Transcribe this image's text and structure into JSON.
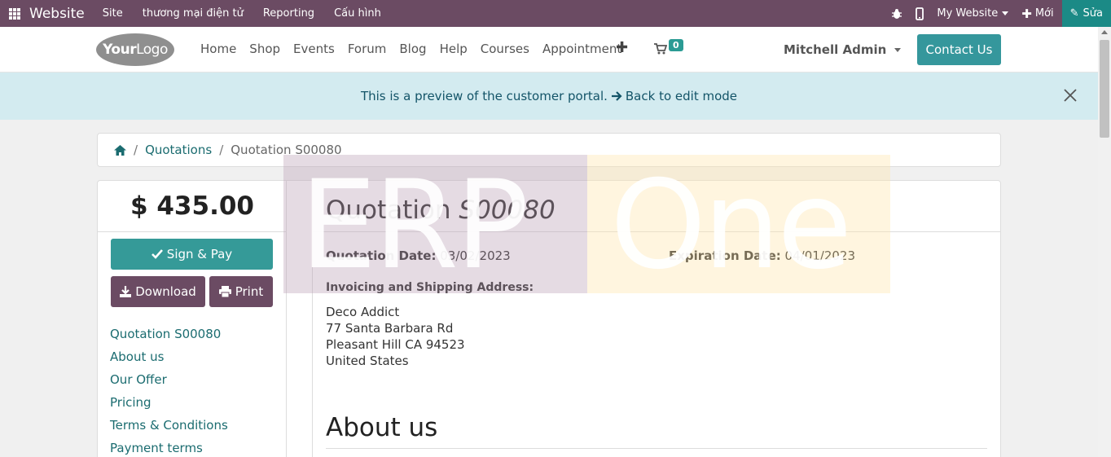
{
  "admin_bar": {
    "app_name": "Website",
    "menus": [
      "Site",
      "thương mại điện tử",
      "Reporting",
      "Cấu hình"
    ],
    "website_selector": "My Website",
    "new_label": "Mới",
    "edit_label": "Sửa"
  },
  "site_nav": {
    "logo_bold": "Your",
    "logo_rest": "Logo",
    "items": [
      "Home",
      "Shop",
      "Events",
      "Forum",
      "Blog",
      "Help",
      "Courses",
      "Appointment"
    ],
    "cart_count": "0",
    "user_name": "Mitchell Admin",
    "contact_label": "Contact Us"
  },
  "banner": {
    "text": "This is a preview of the customer portal.",
    "link_text": "Back to edit mode"
  },
  "breadcrumb": {
    "items": [
      "Quotations",
      "Quotation S00080"
    ]
  },
  "sidebar": {
    "amount": "$ 435.00",
    "sign_label": "Sign & Pay",
    "download_label": "Download",
    "print_label": "Print",
    "toc": [
      "Quotation S00080",
      "About us",
      "Our Offer",
      "Pricing",
      "Terms & Conditions",
      "Payment terms"
    ]
  },
  "quotation": {
    "title_prefix": "Quotation",
    "number": "S00080",
    "date_label": "Quotation Date:",
    "date_value": "03/02/2023",
    "expiration_label": "Expiration Date:",
    "expiration_value": "04/01/2023",
    "address_label": "Invoicing and Shipping Address:",
    "address_lines": [
      "Deco Addict",
      "77 Santa Barbara Rd",
      "Pleasant Hill CA 94523",
      "United States"
    ],
    "section_heading": "About us"
  },
  "watermark": {
    "left": "ERP",
    "right": "One"
  },
  "colors": {
    "admin_bar": "#6b4b63",
    "edit_button": "#1b8a86",
    "accent": "#35979c",
    "banner_bg": "#d3ebf0",
    "link": "#1b6c70"
  }
}
